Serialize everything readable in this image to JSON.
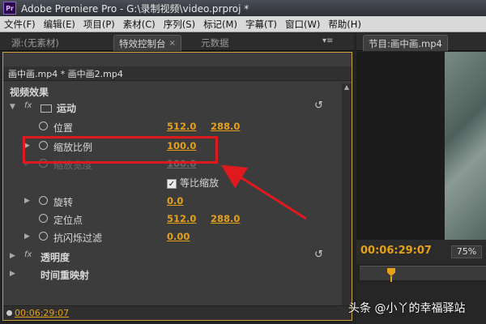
{
  "window": {
    "app_icon": "Pr",
    "title": "Adobe Premiere Pro - G:\\录制视频\\video.prproj *"
  },
  "menu": [
    "文件(F)",
    "编辑(E)",
    "项目(P)",
    "素材(C)",
    "序列(S)",
    "标记(M)",
    "字幕(T)",
    "窗口(W)",
    "帮助(H)"
  ],
  "left_tabs": {
    "source": "源:(无素材)",
    "effect_controls": "特效控制台",
    "metadata": "元数据",
    "close_glyph": "×"
  },
  "right_tabs": {
    "program": "节目:画中画.mp4"
  },
  "effect_controls": {
    "clip": "画中画.mp4 * 画中画2.mp4",
    "video_effects": "视频效果",
    "motion": "运动",
    "position": {
      "label": "位置",
      "x": "512.0",
      "y": "288.0"
    },
    "scale": {
      "label": "缩放比例",
      "value": "100.0"
    },
    "scale_width": {
      "label": "缩放宽度",
      "value": "100.0"
    },
    "uniform_scale": {
      "label": "等比缩放",
      "checked": true,
      "check_glyph": "✓"
    },
    "rotation": {
      "label": "旋转",
      "value": "0.0"
    },
    "anchor": {
      "label": "定位点",
      "x": "512.0",
      "y": "288.0"
    },
    "anti_flicker": {
      "label": "抗闪烁过滤",
      "value": "0.00"
    },
    "opacity": "透明度",
    "time_remap": "时间重映射",
    "fx_glyph": "fx",
    "reset_glyph": "↺",
    "timecode": "00:06:29:07"
  },
  "program_monitor": {
    "timecode": "00:06:29:07",
    "zoom": "75%"
  },
  "watermark": "头条 @小丫的幸福驿站",
  "colors": {
    "accent_value": "#e6a117",
    "highlight_red": "#e0191e",
    "panel_bg": "#3c3c3c"
  }
}
